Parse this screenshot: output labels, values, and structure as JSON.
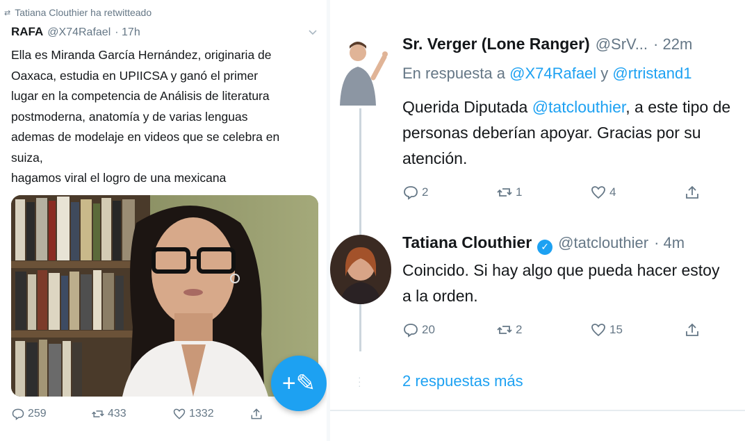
{
  "left": {
    "retweet_note": "Tatiana Clouthier ha retwitteado",
    "author": {
      "name": "RAFA",
      "handle": "@X74Rafael",
      "time": "· 17h"
    },
    "text": "Ella es Miranda García Hernández, originaria de\nOaxaca, estudia en UPIICSA y ganó el primer\nlugar en la competencia de Análisis de literatura\npostmoderna, anatomía y de varias lenguas\nademas de modelaje en videos que se celebra en\nsuiza,\nhagamos viral el logro de una mexicana",
    "counts": {
      "replies": "259",
      "retweets": "433",
      "likes": "1332"
    }
  },
  "right": {
    "tweet1": {
      "name": "Sr. Verger (Lone Ranger)",
      "handle": "@SrV...",
      "time": "· 22m",
      "reply_prefix": "En respuesta a ",
      "reply_user1": "@X74Rafael",
      "reply_join": " y ",
      "reply_user2": "@rtristand1",
      "text_pre": "Querida Diputada ",
      "text_mention": "@tatclouthier",
      "text_post": ", a este tipo de personas deberían apoyar. Gracias por su atención.",
      "counts": {
        "replies": "2",
        "retweets": "1",
        "likes": "4"
      }
    },
    "tweet2": {
      "name": "Tatiana Clouthier",
      "handle": "@tatclouthier",
      "time": "· 4m",
      "text": "Coincido. Si hay algo que pueda hacer estoy a la orden.",
      "counts": {
        "replies": "20",
        "retweets": "2",
        "likes": "15"
      }
    },
    "more_replies": "2 respuestas más"
  },
  "colors": {
    "accent": "#1da1f2",
    "muted": "#657786",
    "text": "#14171a"
  }
}
